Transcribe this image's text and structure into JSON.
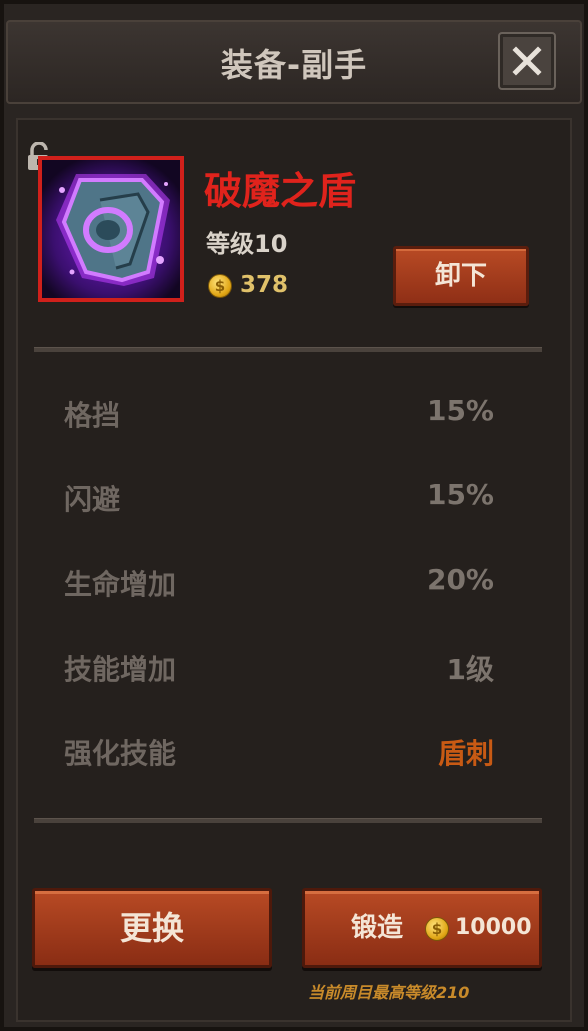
{
  "window": {
    "title": "装备-副手"
  },
  "item": {
    "name": "破魔之盾",
    "level": "等级10",
    "gold": "378",
    "unequip_label": "卸下",
    "icon": "shield-icon"
  },
  "stats": [
    {
      "label": "格挡",
      "value": "15%"
    },
    {
      "label": "闪避",
      "value": "15%"
    },
    {
      "label": "生命增加",
      "value": "20%"
    },
    {
      "label": "技能增加",
      "value": "1级"
    },
    {
      "label": "强化技能",
      "value": "盾刺"
    }
  ],
  "actions": {
    "swap_label": "更换",
    "forge_label": "锻造",
    "forge_cost": "10000",
    "note": "当前周目最高等级210"
  },
  "colors": {
    "item_name": "#e0231c",
    "rare_border": "#d0201b",
    "skill_value": "#c85a14",
    "button": "#a03c1c"
  }
}
